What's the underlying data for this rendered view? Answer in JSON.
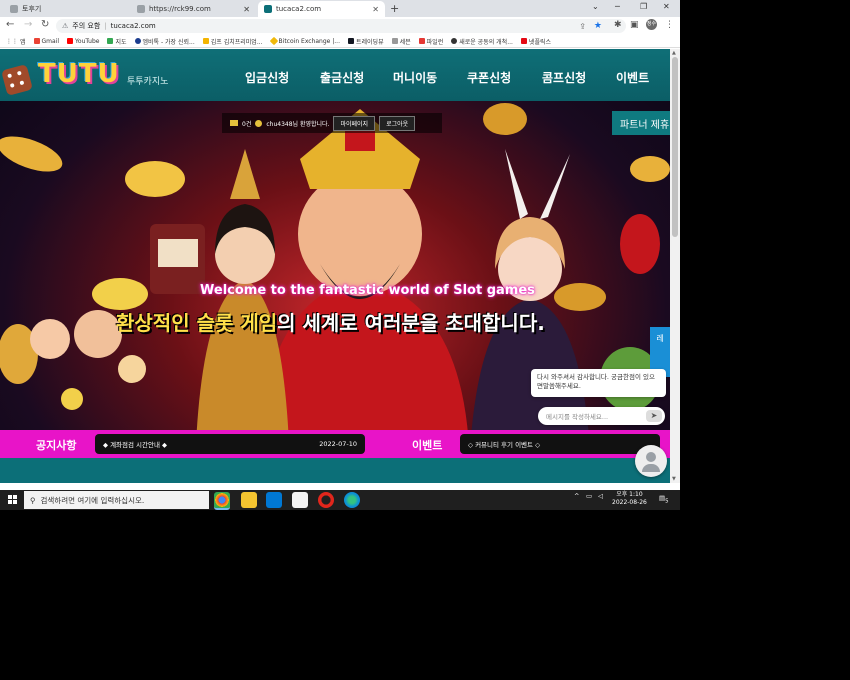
{
  "browser": {
    "tabs": [
      {
        "title": "토후기",
        "active": false
      },
      {
        "title": "https://rck99.com",
        "active": false
      },
      {
        "title": "tucaca2.com",
        "active": true
      }
    ],
    "new_tab_glyph": "+",
    "address": {
      "warning": "주의 요함",
      "url": "tucaca2.com"
    },
    "profile_initials": "정수",
    "bookmarks": [
      "앱",
      "Gmail",
      "YouTube",
      "지도",
      "엠비톡 - 가장 신뢰...",
      "김프 김치프리미엄...",
      "Bitcoin Exchange |...",
      "트레이딩뷰",
      "세븐",
      "파일런",
      "새로운 공동의 개척...",
      "넷플릭스"
    ]
  },
  "site": {
    "logo": "TUTU",
    "logo_sub": "투투카지노",
    "menu": [
      "입금신청",
      "출금신청",
      "머니이동",
      "쿠폰신청",
      "콤프신청",
      "이벤트"
    ],
    "user_bar": {
      "mail_count": "0건",
      "greeting": "chu4348님 환영합니다.",
      "mypage": "마이페이지",
      "logout": "로그아웃"
    },
    "partner": "파트너 제휴",
    "welcome_en": "Welcome to the fantastic world of Slot games",
    "welcome_kr_highlight": "환상적인 슬롯 게임",
    "welcome_kr_rest": "의 세계로 여러분을 초대합니다.",
    "notice": {
      "title": "공지사항",
      "item": "◆ 계좌점검 시간안내 ◆",
      "date": "2022-07-10"
    },
    "event": {
      "title": "이벤트",
      "item": "◇ 커뮤니티 후기 이벤트 ◇"
    },
    "chat": {
      "message": "다시 와주셔서 감사합니다. 궁금한점이 있으면말씀해주세요.",
      "placeholder": "메시지를 작성하세요...",
      "side_tab": "레"
    }
  },
  "taskbar": {
    "search_placeholder": "검색하려면 여기에 입력하십시오.",
    "time": "오후 1:10",
    "date": "2022-08-26",
    "notification_count": "5"
  },
  "colors": {
    "teal": "#0c6f78",
    "magenta": "#e814c8",
    "logo_yellow": "#ffd23a"
  }
}
